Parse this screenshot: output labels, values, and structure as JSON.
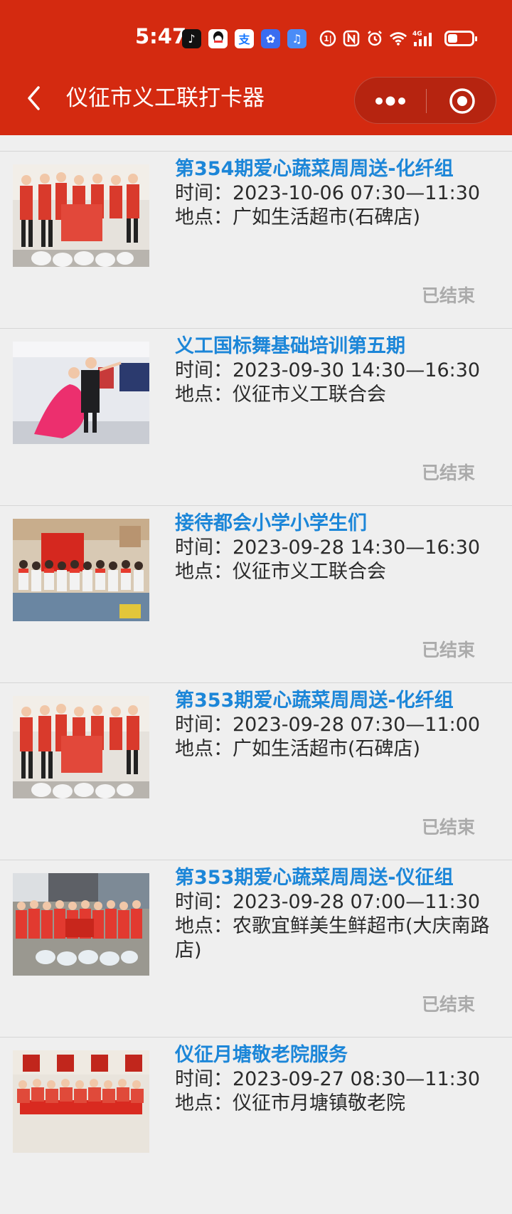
{
  "status_bar": {
    "time": "5:47",
    "app_icons": [
      "tiktok-icon",
      "qq-icon",
      "alipay-icon",
      "app-icon",
      "music-icon"
    ],
    "system_icons": [
      "nfc-icon",
      "alarm-icon",
      "wifi-icon",
      "signal-4g-icon",
      "battery-icon"
    ],
    "network": "4G"
  },
  "header": {
    "title": "仪征市义工联打卡器",
    "back_icon": "chevron-left-icon",
    "more_icon": "more-dots-icon",
    "close_icon": "target-close-icon",
    "bg_color": "#d42a10"
  },
  "items": [
    {
      "title": "第354期爱心蔬菜周周送-化纤组",
      "time_label": "时间：",
      "time": "2023-10-06 07:30—11:30",
      "place_label": "地点：",
      "place": "广如生活超市(石碑店)",
      "status": "已结束"
    },
    {
      "title": "义工国标舞基础培训第五期",
      "time_label": "时间：",
      "time": "2023-09-30 14:30—16:30",
      "place_label": "地点：",
      "place": "仪征市义工联合会",
      "status": "已结束"
    },
    {
      "title": "接待都会小学小学生们",
      "time_label": "时间：",
      "time": "2023-09-28 14:30—16:30",
      "place_label": "地点：",
      "place": "仪征市义工联合会",
      "status": "已结束"
    },
    {
      "title": "第353期爱心蔬菜周周送-化纤组",
      "time_label": "时间：",
      "time": "2023-09-28 07:30—11:00",
      "place_label": "地点：",
      "place": "广如生活超市(石碑店)",
      "status": "已结束"
    },
    {
      "title": "第353期爱心蔬菜周周送-仪征组",
      "time_label": "时间：",
      "time": "2023-09-28 07:00—11:30",
      "place_label": "地点：",
      "place": "农歌宜鲜美生鲜超市(大庆南路店)",
      "status": "已结束"
    },
    {
      "title": "仪征月塘敬老院服务",
      "time_label": "时间：",
      "time": "2023-09-27 08:30—11:30",
      "place_label": "地点：",
      "place": "仪征市月塘镇敬老院",
      "status": ""
    }
  ],
  "colors": {
    "accent": "#d42a10",
    "title_blue": "#1c86d8",
    "status_grey": "#ababab",
    "background": "#efefef"
  }
}
